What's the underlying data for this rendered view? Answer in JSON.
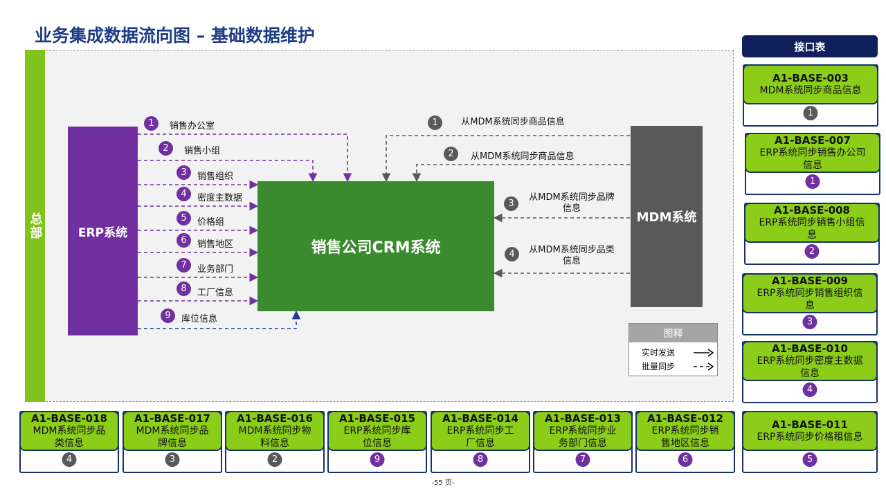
{
  "title": "业务集成数据流向图 – 基础数据维护",
  "hq_label": "总部",
  "systems": {
    "erp": "ERP系统",
    "crm": "销售公司CRM系统",
    "mdm": "MDM系统"
  },
  "erp_flows": [
    {
      "num": "1",
      "label": "销售办公室"
    },
    {
      "num": "2",
      "label": "销售小组"
    },
    {
      "num": "3",
      "label": "销售组织"
    },
    {
      "num": "4",
      "label": "密度主数据"
    },
    {
      "num": "5",
      "label": "价格组"
    },
    {
      "num": "6",
      "label": "销售地区"
    },
    {
      "num": "7",
      "label": "业务部门"
    },
    {
      "num": "8",
      "label": "工厂信息"
    },
    {
      "num": "9",
      "label": "库位信息"
    }
  ],
  "mdm_flows": [
    {
      "num": "1",
      "label": "从MDM系统同步商品信息"
    },
    {
      "num": "2",
      "label": "从MDM系统同步商品信息"
    },
    {
      "num": "3",
      "label": "从MDM系统同步品牌信息"
    },
    {
      "num": "4",
      "label": "从MDM系统同步品类信息"
    }
  ],
  "legend": {
    "title": "图释",
    "realtime": "实时发送",
    "batch": "批量同步"
  },
  "interface_header": "接口表",
  "interface_cards_right": [
    {
      "id": "A1-BASE-003",
      "desc": "MDM系统同步商品信息",
      "num": "1",
      "color": "#595959"
    },
    {
      "id": "A1-BASE-007",
      "desc": "ERP系统同步销售办公司信息",
      "num": "1",
      "color": "#7030a0"
    },
    {
      "id": "A1-BASE-008",
      "desc": "ERP系统同步销售小组信息",
      "num": "2",
      "color": "#7030a0"
    },
    {
      "id": "A1-BASE-009",
      "desc": "ERP系统同步销售组织信息",
      "num": "3",
      "color": "#7030a0"
    },
    {
      "id": "A1-BASE-010",
      "desc": "ERP系统同步密度主数据信息",
      "num": "4",
      "color": "#7030a0"
    }
  ],
  "interface_cards_bottom": [
    {
      "id": "A1-BASE-018",
      "desc": "MDM系统同步品类信息",
      "num": "4",
      "color": "#595959"
    },
    {
      "id": "A1-BASE-017",
      "desc": "MDM系统同步品牌信息",
      "num": "3",
      "color": "#595959"
    },
    {
      "id": "A1-BASE-016",
      "desc": "MDM系统同步物料信息",
      "num": "2",
      "color": "#595959"
    },
    {
      "id": "A1-BASE-015",
      "desc": "ERP系统同步库位信息",
      "num": "9",
      "color": "#7030a0"
    },
    {
      "id": "A1-BASE-014",
      "desc": "ERP系统同步工厂信息",
      "num": "8",
      "color": "#7030a0"
    },
    {
      "id": "A1-BASE-013",
      "desc": "ERP系统同步业务部门信息",
      "num": "7",
      "color": "#7030a0"
    },
    {
      "id": "A1-BASE-012",
      "desc": "ERP系统同步销售地区信息",
      "num": "6",
      "color": "#7030a0"
    },
    {
      "id": "A1-BASE-011",
      "desc": "ERP系统同步价格租信息",
      "num": "5",
      "color": "#7030a0"
    }
  ],
  "footer": "-55 页-"
}
